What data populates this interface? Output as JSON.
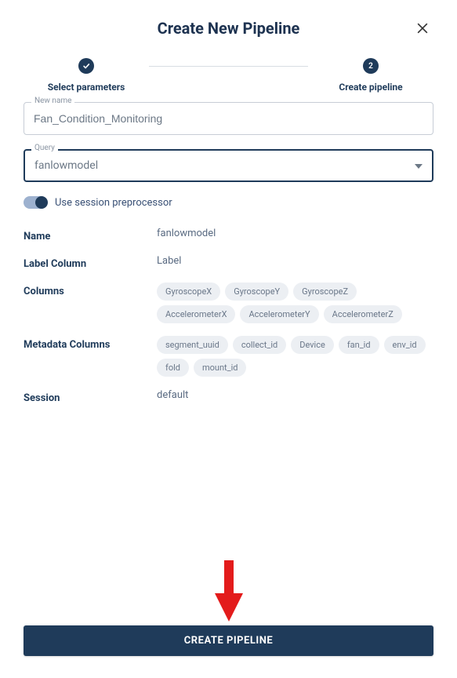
{
  "header": {
    "title": "Create New Pipeline"
  },
  "stepper": {
    "step1_label": "Select parameters",
    "step2_label": "Create pipeline",
    "step2_num": "2"
  },
  "form": {
    "newname_legend": "New name",
    "newname_value": "Fan_Condition_Monitoring",
    "query_legend": "Query",
    "query_value": "fanlowmodel"
  },
  "toggle": {
    "label": "Use session preprocessor"
  },
  "details": {
    "name_label": "Name",
    "name_value": "fanlowmodel",
    "labelcol_label": "Label Column",
    "labelcol_value": "Label",
    "columns_label": "Columns",
    "columns": [
      "GyroscopeX",
      "GyroscopeY",
      "GyroscopeZ",
      "AccelerometerX",
      "AccelerometerY",
      "AccelerometerZ"
    ],
    "metadata_label": "Metadata Columns",
    "metadata": [
      "segment_uuid",
      "collect_id",
      "Device",
      "fan_id",
      "env_id",
      "fold",
      "mount_id"
    ],
    "session_label": "Session",
    "session_value": "default"
  },
  "buttons": {
    "create": "CREATE PIPELINE"
  }
}
